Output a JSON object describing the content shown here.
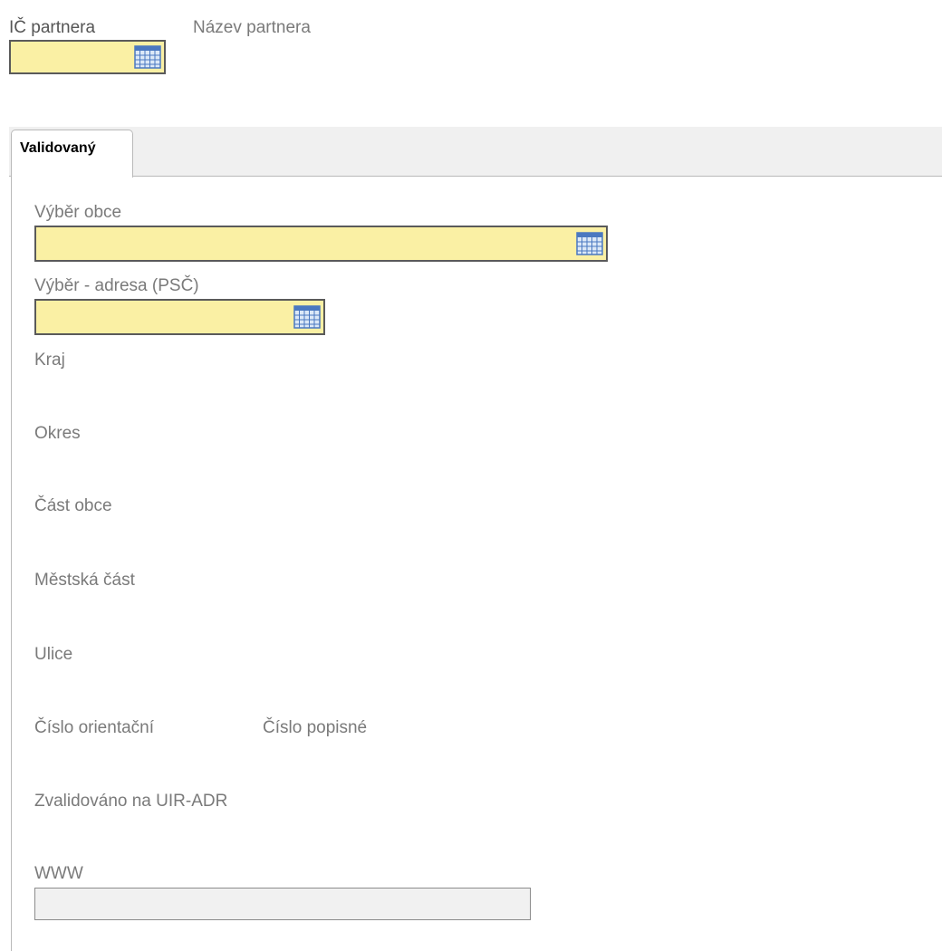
{
  "header": {
    "ic_label": "IČ partnera",
    "name_label": "Název partnera"
  },
  "tabs": [
    {
      "label": "Validovaný",
      "active": true
    }
  ],
  "form": {
    "municipality_label": "Výběr obce",
    "address_label": "Výběr - adresa (PSČ)",
    "region_label": "Kraj",
    "district_label": "Okres",
    "part_label": "Část obce",
    "city_district_label": "Městská část",
    "street_label": "Ulice",
    "orient_number_label": "Číslo orientační",
    "house_number_label": "Číslo popisné",
    "validated_label": "Zvalidováno na UIR-ADR",
    "www_label": "WWW",
    "www_value": ""
  },
  "icons": {
    "lookup": "calendar-grid-icon"
  },
  "colors": {
    "required_field": "#faf0a4",
    "readonly_field": "#f1f1f1",
    "icon_blue": "#4a78c0"
  }
}
